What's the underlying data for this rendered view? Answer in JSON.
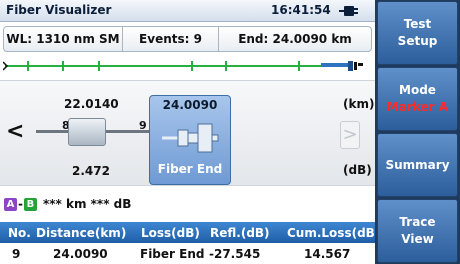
{
  "app": {
    "title": "Fiber Visualizer",
    "time": "16:41:54"
  },
  "info": {
    "wavelength": "WL: 1310 nm SM",
    "events": "Events: 9",
    "end": "End: 24.0090 km"
  },
  "event_view": {
    "nav_prev": "<",
    "nav_next": ">",
    "unit_distance": "(km)",
    "unit_loss": "(dB)",
    "prev_event": {
      "distance": "22.0140",
      "loss": "2.472",
      "segment_left": "8",
      "segment_right": "9"
    },
    "selected_event": {
      "distance": "24.0090",
      "label": "Fiber End"
    }
  },
  "markers": {
    "a": "A",
    "b": "B",
    "dash": "-",
    "readout": "*** km  *** dB"
  },
  "table": {
    "headers": [
      "No.",
      "Distance(km)",
      "Loss(dB)",
      "Refl.(dB)",
      "Cum.Loss(dB)"
    ],
    "row": {
      "no": "9",
      "distance": "24.0090",
      "loss": "Fiber End",
      "refl": "-27.545",
      "cum_loss": "14.567"
    }
  },
  "softkeys": [
    {
      "line1": "Test",
      "line2": "Setup"
    },
    {
      "line1": "Mode",
      "line2": "Marker A"
    },
    {
      "line1": "Summary"
    },
    {
      "line1": "Trace",
      "line2": "View"
    }
  ],
  "colors": {
    "softkey_bg": "#3f74b5",
    "table_header_bg": "#2e73c0",
    "selected_event_bg": "#8db1e2",
    "marker_a": "#8e44c7",
    "marker_b": "#27a23b",
    "overview_trace": "#27b040",
    "mode_value": "#ff2a2a"
  },
  "icons": {
    "battery": "battery-icon",
    "end_connector": "fiber-end-connector-icon",
    "event_connector": "connector-event-icon",
    "overview_marker": "fiber-end-marker-icon"
  }
}
